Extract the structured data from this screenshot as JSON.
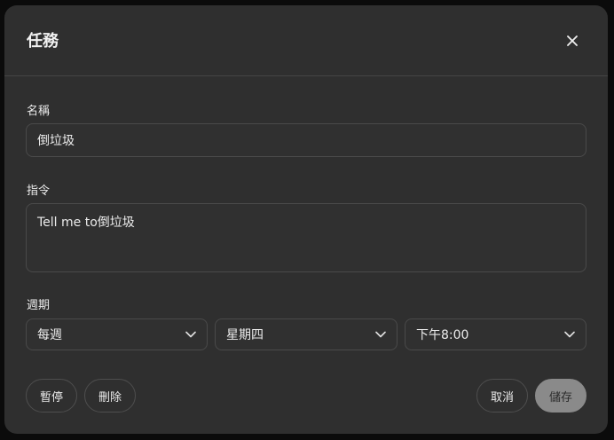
{
  "dialog": {
    "title": "任務",
    "close_icon": "close-icon"
  },
  "form": {
    "name_label": "名稱",
    "name_value": "倒垃圾",
    "instruction_label": "指令",
    "instruction_value": "Tell me to倒垃圾",
    "period_label": "週期",
    "frequency": "每週",
    "weekday": "星期四",
    "time": "下午8:00"
  },
  "actions": {
    "pause_label": "暫停",
    "delete_label": "刪除",
    "cancel_label": "取消",
    "save_label": "儲存"
  },
  "colors": {
    "dialog_bg": "#2f2f2f",
    "page_bg": "#0b0b0b",
    "save_disabled_bg": "#8a8a8a"
  }
}
